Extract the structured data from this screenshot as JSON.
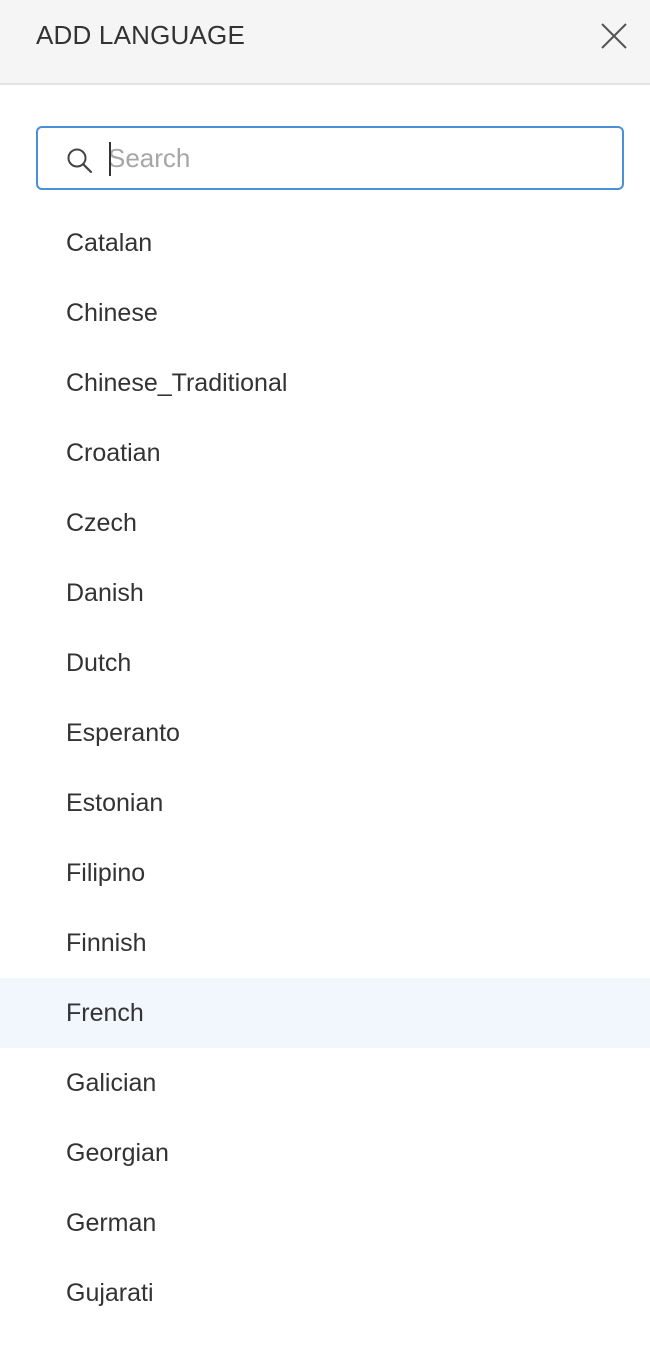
{
  "header": {
    "title": "ADD LANGUAGE",
    "close_icon": "close-icon"
  },
  "search": {
    "placeholder": "Search",
    "value": "",
    "icon": "search-icon"
  },
  "colors": {
    "accent": "#4a90d9",
    "header_bg": "#f5f5f5",
    "hover_bg": "#f2f7fe",
    "text": "#333333"
  },
  "languages": {
    "items": [
      {
        "label": "Catalan"
      },
      {
        "label": "Chinese"
      },
      {
        "label": "Chinese_Traditional"
      },
      {
        "label": "Croatian"
      },
      {
        "label": "Czech"
      },
      {
        "label": "Danish"
      },
      {
        "label": "Dutch"
      },
      {
        "label": "Esperanto"
      },
      {
        "label": "Estonian"
      },
      {
        "label": "Filipino"
      },
      {
        "label": "Finnish"
      },
      {
        "label": "French",
        "highlighted": true
      },
      {
        "label": "Galician"
      },
      {
        "label": "Georgian"
      },
      {
        "label": "German"
      },
      {
        "label": "Gujarati"
      }
    ]
  }
}
